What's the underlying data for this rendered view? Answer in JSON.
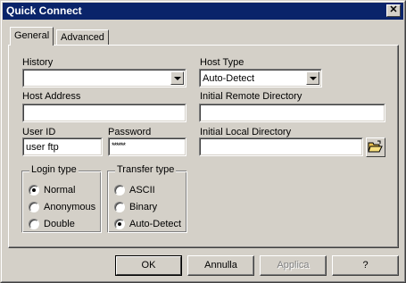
{
  "window": {
    "title": "Quick Connect",
    "close_glyph": "✕"
  },
  "tabs": [
    {
      "label": "General",
      "active": true
    },
    {
      "label": "Advanced",
      "active": false
    }
  ],
  "fields": {
    "history": {
      "label": "History",
      "value": ""
    },
    "host_type": {
      "label": "Host Type",
      "value": "Auto-Detect"
    },
    "host_address": {
      "label": "Host Address",
      "value": ""
    },
    "initial_remote_directory": {
      "label": "Initial Remote Directory",
      "value": ""
    },
    "user_id": {
      "label": "User ID",
      "value": "user ftp"
    },
    "password": {
      "label": "Password",
      "value": "******"
    },
    "initial_local_directory": {
      "label": "Initial Local Directory",
      "value": ""
    }
  },
  "login_type": {
    "label": "Login type",
    "options": [
      {
        "label": "Normal",
        "checked": true
      },
      {
        "label": "Anonymous",
        "checked": false
      },
      {
        "label": "Double",
        "checked": false
      }
    ]
  },
  "transfer_type": {
    "label": "Transfer type",
    "options": [
      {
        "label": "ASCII",
        "checked": false
      },
      {
        "label": "Binary",
        "checked": false
      },
      {
        "label": "Auto-Detect",
        "checked": true
      }
    ]
  },
  "buttons": {
    "ok": "OK",
    "cancel": "Annulla",
    "apply": "Applica",
    "help": "?"
  },
  "icons": {
    "close": "close-icon",
    "dropdown": "chevron-down-icon",
    "browse": "open-folder-icon"
  },
  "colors": {
    "titlebar": "#0a246a",
    "face": "#d4d0c8",
    "folder": "#e8c050"
  }
}
